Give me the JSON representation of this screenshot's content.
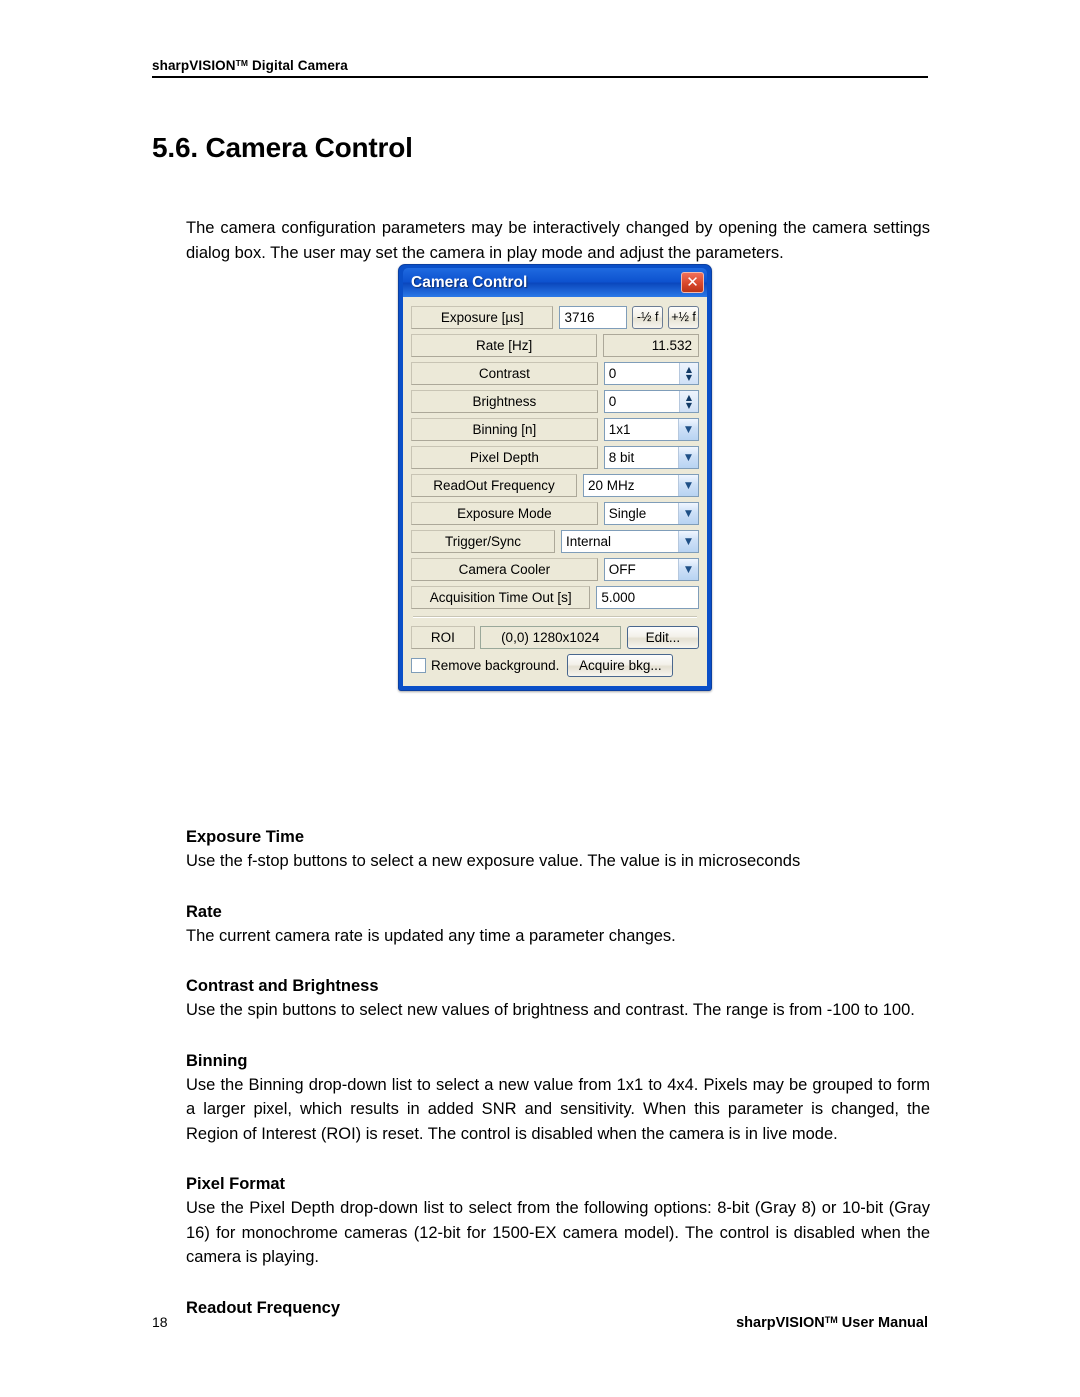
{
  "header": {
    "brand": "sharpVISION",
    "trademark": "TM",
    "product": " Digital Camera"
  },
  "chapter": {
    "title": "5.6. Camera Control"
  },
  "intro": {
    "paragraph": "The camera configuration parameters may be interactively changed by opening the camera settings dialog box. The user may set the camera in play mode and adjust the parameters."
  },
  "dialog": {
    "title": "Camera Control",
    "close_icon": "close-icon",
    "rows": {
      "exposure": {
        "label": "Exposure [µs]",
        "value": "3716",
        "minus_half_stop": "-½ f",
        "plus_half_stop": "+½ f"
      },
      "rate": {
        "label": "Rate [Hz]",
        "value": "11.532"
      },
      "contrast": {
        "label": "Contrast",
        "value": "0"
      },
      "brightness": {
        "label": "Brightness",
        "value": "0"
      },
      "binning": {
        "label": "Binning [n]",
        "value": "1x1"
      },
      "pixel_depth": {
        "label": "Pixel Depth",
        "value": "8 bit"
      },
      "readout_frequency": {
        "label": "ReadOut Frequency",
        "value": "20 MHz"
      },
      "exposure_mode": {
        "label": "Exposure Mode",
        "value": "Single"
      },
      "trigger_sync": {
        "label": "Trigger/Sync",
        "value": "Internal"
      },
      "camera_cooler": {
        "label": "Camera Cooler",
        "value": "OFF"
      },
      "acquisition_timeout": {
        "label": "Acquisition Time Out [s]",
        "value": "5.000"
      },
      "roi": {
        "label": "ROI",
        "value": "(0,0) 1280x1024",
        "edit_button": "Edit..."
      },
      "remove_background": {
        "label": "Remove background.",
        "checked": false,
        "acquire_button": "Acquire bkg..."
      }
    },
    "colors": {
      "titlebar_blue": "#0a4fc8",
      "client_beige": "#ece9d8",
      "close_red": "#d9482c",
      "field_border": "#7f9db9"
    }
  },
  "sections": [
    {
      "heading": "Exposure Time",
      "body": "Use the f-stop buttons to select a new exposure value. The value is in microseconds"
    },
    {
      "heading": "Rate",
      "body": "The current camera rate is updated any time a parameter changes."
    },
    {
      "heading": "Contrast and Brightness",
      "body": "Use the spin buttons to select new values of brightness and contrast. The range is from -100 to 100."
    },
    {
      "heading": "Binning",
      "body": "Use the Binning drop-down list to select a new value from 1x1 to 4x4. Pixels may be grouped to form a larger pixel, which results in added SNR and sensitivity. When this parameter is changed, the Region of Interest (ROI) is reset. The control is disabled when the camera is in live mode."
    },
    {
      "heading": "Pixel Format",
      "body": "Use the Pixel Depth drop-down list to select from the following options: 8-bit (Gray 8) or 10-bit (Gray 16) for monochrome cameras (12-bit for 1500-EX camera model). The control is disabled when the camera is playing."
    },
    {
      "heading": "Readout Frequency",
      "body": ""
    }
  ],
  "footer": {
    "page_number": "18",
    "manual_brand": "sharpVISION",
    "manual_trademark": "TM",
    "manual_suffix": " User Manual"
  }
}
